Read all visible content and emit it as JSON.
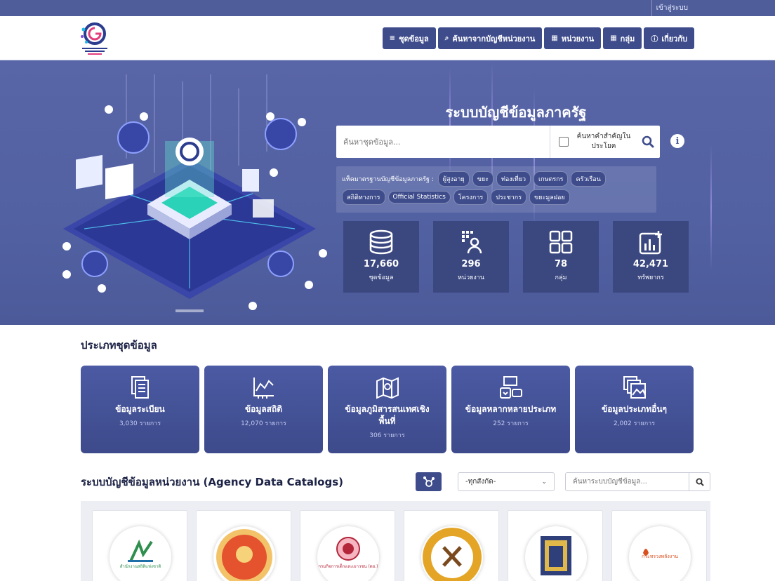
{
  "topbar": {
    "login": "เข้าสู่ระบบ"
  },
  "nav": [
    {
      "icon": "database-icon",
      "glyph": "≡",
      "label": "ชุดข้อมูล"
    },
    {
      "icon": "search-icon",
      "glyph": "⌕",
      "label": "ค้นหาจากบัญชีหน่วยงาน"
    },
    {
      "icon": "building-icon",
      "glyph": "▦",
      "label": "หน่วยงาน"
    },
    {
      "icon": "grid-icon",
      "glyph": "▦",
      "label": "กลุ่ม"
    },
    {
      "icon": "info-icon",
      "glyph": "ⓘ",
      "label": "เกี่ยวกับ"
    }
  ],
  "hero": {
    "title": "ระบบบัญชีข้อมูลภาครัฐ",
    "search_placeholder": "ค้นหาชุดข้อมูล...",
    "search_option": "ค้นหาคำสำคัญใน ประโยค",
    "tags_label": "แท็คมาตรฐานบัญชีข้อมูลภาครัฐ :",
    "tags": [
      "ผู้สูงอายุ",
      "ขยะ",
      "ท่องเที่ยว",
      "เกษตรกร",
      "ครัวเรือน",
      "สถิติทางการ",
      "Official Statistics",
      "โครงการ",
      "ประชากร",
      "ขยะมูลฝอย"
    ]
  },
  "stats": [
    {
      "icon": "database-icon",
      "value": "17,660",
      "label": "ชุดข้อมูล"
    },
    {
      "icon": "agency-icon",
      "value": "296",
      "label": "หน่วยงาน"
    },
    {
      "icon": "group-icon",
      "value": "78",
      "label": "กลุ่ม"
    },
    {
      "icon": "resource-chart-icon",
      "value": "42,471",
      "label": "ทรัพยากร"
    }
  ],
  "categories_section": {
    "title": "ประเภทชุดข้อมูล",
    "items": [
      {
        "icon": "document-icon",
        "name": "ข้อมูลระเบียน",
        "count": "3,030 รายการ"
      },
      {
        "icon": "stats-chart-icon",
        "name": "ข้อมูลสถิติ",
        "count": "12,070 รายการ"
      },
      {
        "icon": "map-icon",
        "name": "ข้อมูลภูมิสารสนเทศเชิงพื้นที่",
        "count": "306 รายการ"
      },
      {
        "icon": "multimedia-icon",
        "name": "ข้อมูลหลากหลายประเภท",
        "count": "252 รายการ"
      },
      {
        "icon": "other-files-icon",
        "name": "ข้อมูลประเภทอื่นๆ",
        "count": "2,002 รายการ"
      }
    ]
  },
  "agency_section": {
    "title": "ระบบบัญชีข้อมูลหน่วยงาน (Agency Data Catalogs)",
    "select_value": "-ทุกสังกัด-",
    "search_placeholder": "ค้นหาระบบบัญชีข้อมูล...",
    "agencies": [
      {
        "logo_text": "สำนักงานสถิติแห่งชาติ",
        "color": "#2f8f4e"
      },
      {
        "logo_text": "",
        "color": "#d6772a"
      },
      {
        "logo_text": "กรมกิจการเด็กและเยาวชน (ดย.)",
        "color": "#b3263a"
      },
      {
        "logo_text": "",
        "color": "#e4a526"
      },
      {
        "logo_text": "",
        "color": "#2e3f7a"
      },
      {
        "logo_text": "กระทรวงพลังงาน",
        "color": "#d9501e"
      }
    ]
  },
  "colors": {
    "primary": "#3e4c8c",
    "hero": "#5261a2"
  }
}
